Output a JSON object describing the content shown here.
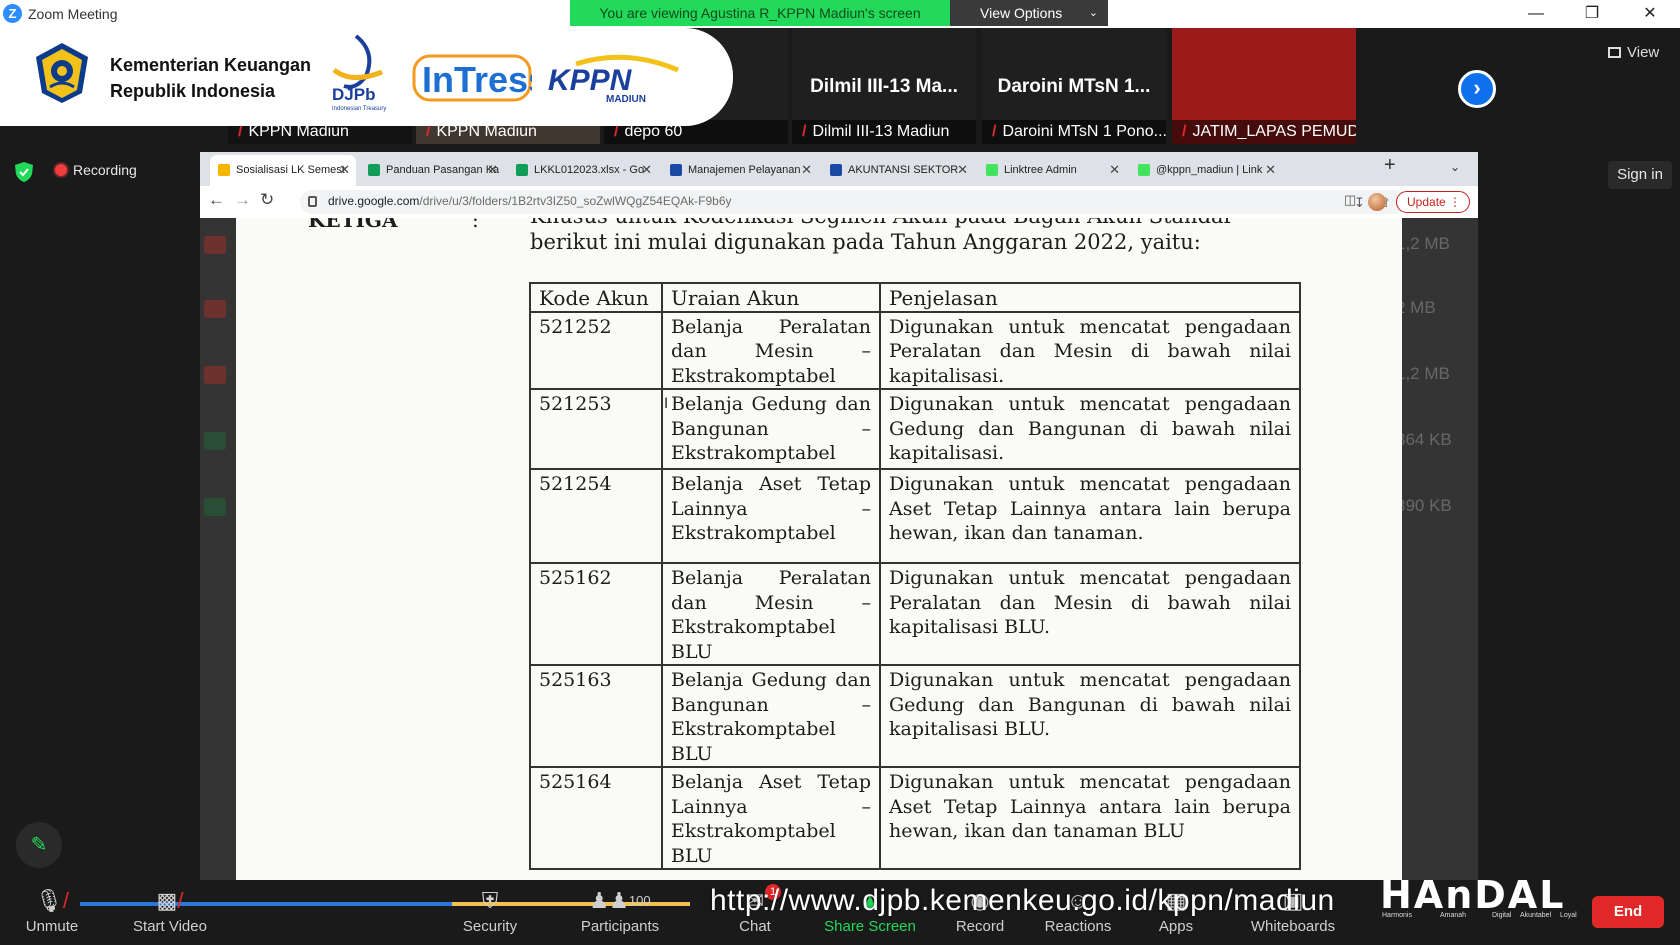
{
  "window": {
    "title": "Zoom Meeting",
    "minimize": "—",
    "maximize": "❐",
    "close": "✕"
  },
  "banner": {
    "viewing_text": "You are viewing Agustina R_KPPN Madiun's screen",
    "view_options_label": "View Options"
  },
  "logos": {
    "kemenkeu_line1": "Kementerian Keuangan",
    "kemenkeu_line2": "Republik Indonesia",
    "djpb": "DJPb",
    "djpb_sub": "Indonesian Treasury",
    "intress": "InTress",
    "kppn": "KPPN",
    "kppn_sub": "MADIUN"
  },
  "thumbnails": [
    {
      "title": "",
      "name": "KPPN Madiun",
      "bg": "#2b2b2b"
    },
    {
      "title": "",
      "name": "KPPN Madiun",
      "bg": "#8c7a6a"
    },
    {
      "title": "depo 60",
      "name": "depo 60",
      "bg": "#1f1f1f"
    },
    {
      "title": "Dilmil III-13 Ma...",
      "name": "Dilmil III-13 Madiun",
      "bg": "#1f1f1f"
    },
    {
      "title": "Daroini MTsN 1...",
      "name": "Daroini MTsN 1 Pono...",
      "bg": "#1f1f1f"
    },
    {
      "title": "",
      "name": "JATIM_LAPAS PEMUD...",
      "bg": "#9b1b1b"
    }
  ],
  "header_right": {
    "view_label": "View",
    "sign_in_label": "Sign in"
  },
  "status": {
    "recording_label": "Recording"
  },
  "browser": {
    "tabs": [
      {
        "label": "Sosialisasi LK Semest",
        "color": "#f4b400",
        "active": true
      },
      {
        "label": "Panduan Pasangan Ka",
        "color": "#0f9d58",
        "active": false
      },
      {
        "label": "LKKL012023.xlsx - Go",
        "color": "#0f9d58",
        "active": false
      },
      {
        "label": "Manajemen Pelayanan",
        "color": "#1a4aa8",
        "active": false
      },
      {
        "label": "AKUNTANSI SEKTOR",
        "color": "#1a4aa8",
        "active": false
      },
      {
        "label": "Linktree Admin",
        "color": "#43e55e",
        "active": false
      },
      {
        "label": "@kppn_madiun | Link",
        "color": "#43e55e",
        "active": false
      }
    ],
    "url_host": "drive.google.com",
    "url_path": "/drive/u/3/folders/1B2rtv3IZ50_soZwlWQgZ54EQAk-F9b6y",
    "update_label": "Update"
  },
  "drive_ghost": {
    "sizes": [
      "1,2 MB",
      "2 MB",
      "1,2 MB",
      "364 KB",
      "390 KB"
    ],
    "colors": [
      "#d93025",
      "#d93025",
      "#d93025",
      "#188038",
      "#188038"
    ]
  },
  "document": {
    "heading_label": "KETIGA",
    "heading_colon": ":",
    "heading_line1": "Khusus untuk Kodefikasi Segmen Akun pada Bagan Akun Standar",
    "heading_line2": "berikut ini mulai digunakan pada Tahun Anggaran 2022, yaitu:",
    "table": {
      "headers": [
        "Kode Akun",
        "Uraian Akun",
        "Penjelasan"
      ],
      "rows": [
        {
          "code": "521252",
          "uraian": "Belanja Peralatan dan Mesin – Ekstrakomptabel",
          "penjelasan": "Digunakan untuk mencatat pengadaan Peralatan dan Mesin di bawah nilai kapitalisasi."
        },
        {
          "code": "521253",
          "uraian": "Belanja Gedung dan Bangunan – Ekstrakomptabel",
          "penjelasan": "Digunakan untuk mencatat pengadaan Gedung dan Bangunan di bawah nilai kapitalisasi."
        },
        {
          "code": "521254",
          "uraian": "Belanja Aset Tetap Lainnya – Ekstrakomptabel",
          "penjelasan": "Digunakan untuk mencatat pengadaan Aset Tetap Lainnya antara lain berupa hewan, ikan dan tanaman."
        },
        {
          "code": "525162",
          "uraian": "Belanja Peralatan dan Mesin – Ekstrakomptabel BLU",
          "penjelasan": "Digunakan untuk mencatat pengadaan Peralatan dan Mesin di bawah nilai kapitalisasi BLU."
        },
        {
          "code": "525163",
          "uraian": "Belanja Gedung dan Bangunan – Ekstrakomptabel BLU",
          "penjelasan": "Digunakan untuk mencatat pengadaan Gedung dan Bangunan di bawah nilai kapitalisasi BLU."
        },
        {
          "code": "525164",
          "uraian": "Belanja Aset Tetap Lainnya – Ekstrakomptabel BLU",
          "penjelasan": "Digunakan untuk mencatat pengadaan Aset Tetap Lainnya antara lain berupa hewan, ikan dan tanaman BLU"
        }
      ]
    }
  },
  "toolbar": {
    "unmute": "Unmute",
    "start_video": "Start Video",
    "security": "Security",
    "participants": "Participants",
    "participants_count": "100",
    "chat": "Chat",
    "chat_badge": "1",
    "share_screen": "Share Screen",
    "record": "Record",
    "reactions": "Reactions",
    "apps": "Apps",
    "whiteboards": "Whiteboards",
    "end": "End",
    "progress_fraction": 0.61
  },
  "overlay": {
    "url": "http://www.djpb.kemenkeu.go.id/kppn/madiun",
    "handal": "HAnDAL",
    "handal_tags": [
      "Harmonis",
      "Amanah",
      "Digital",
      "Akuntabel",
      "Loyal"
    ]
  }
}
